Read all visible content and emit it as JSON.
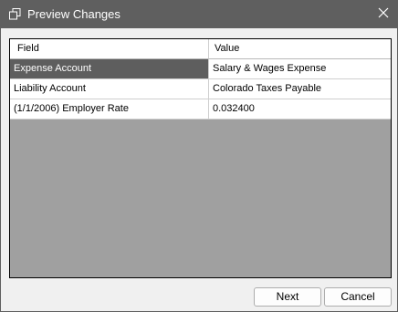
{
  "window": {
    "title": "Preview Changes",
    "title_bar_color": "#5f5f5f",
    "app_icon": "preview-window-icon",
    "close_icon": "close-icon"
  },
  "grid": {
    "columns": [
      "Field",
      "Value"
    ],
    "rows": [
      {
        "field": "Expense Account",
        "value": "Salary & Wages Expense",
        "selected": true
      },
      {
        "field": "Liability Account",
        "value": "Colorado Taxes Payable",
        "selected": false
      },
      {
        "field": "(1/1/2006) Employer Rate",
        "value": "0.032400",
        "selected": false
      }
    ],
    "selection_color": "#5e5e5e",
    "empty_area_color": "#a0a0a0"
  },
  "buttons": {
    "next_label": "Next",
    "cancel_label": "Cancel"
  }
}
